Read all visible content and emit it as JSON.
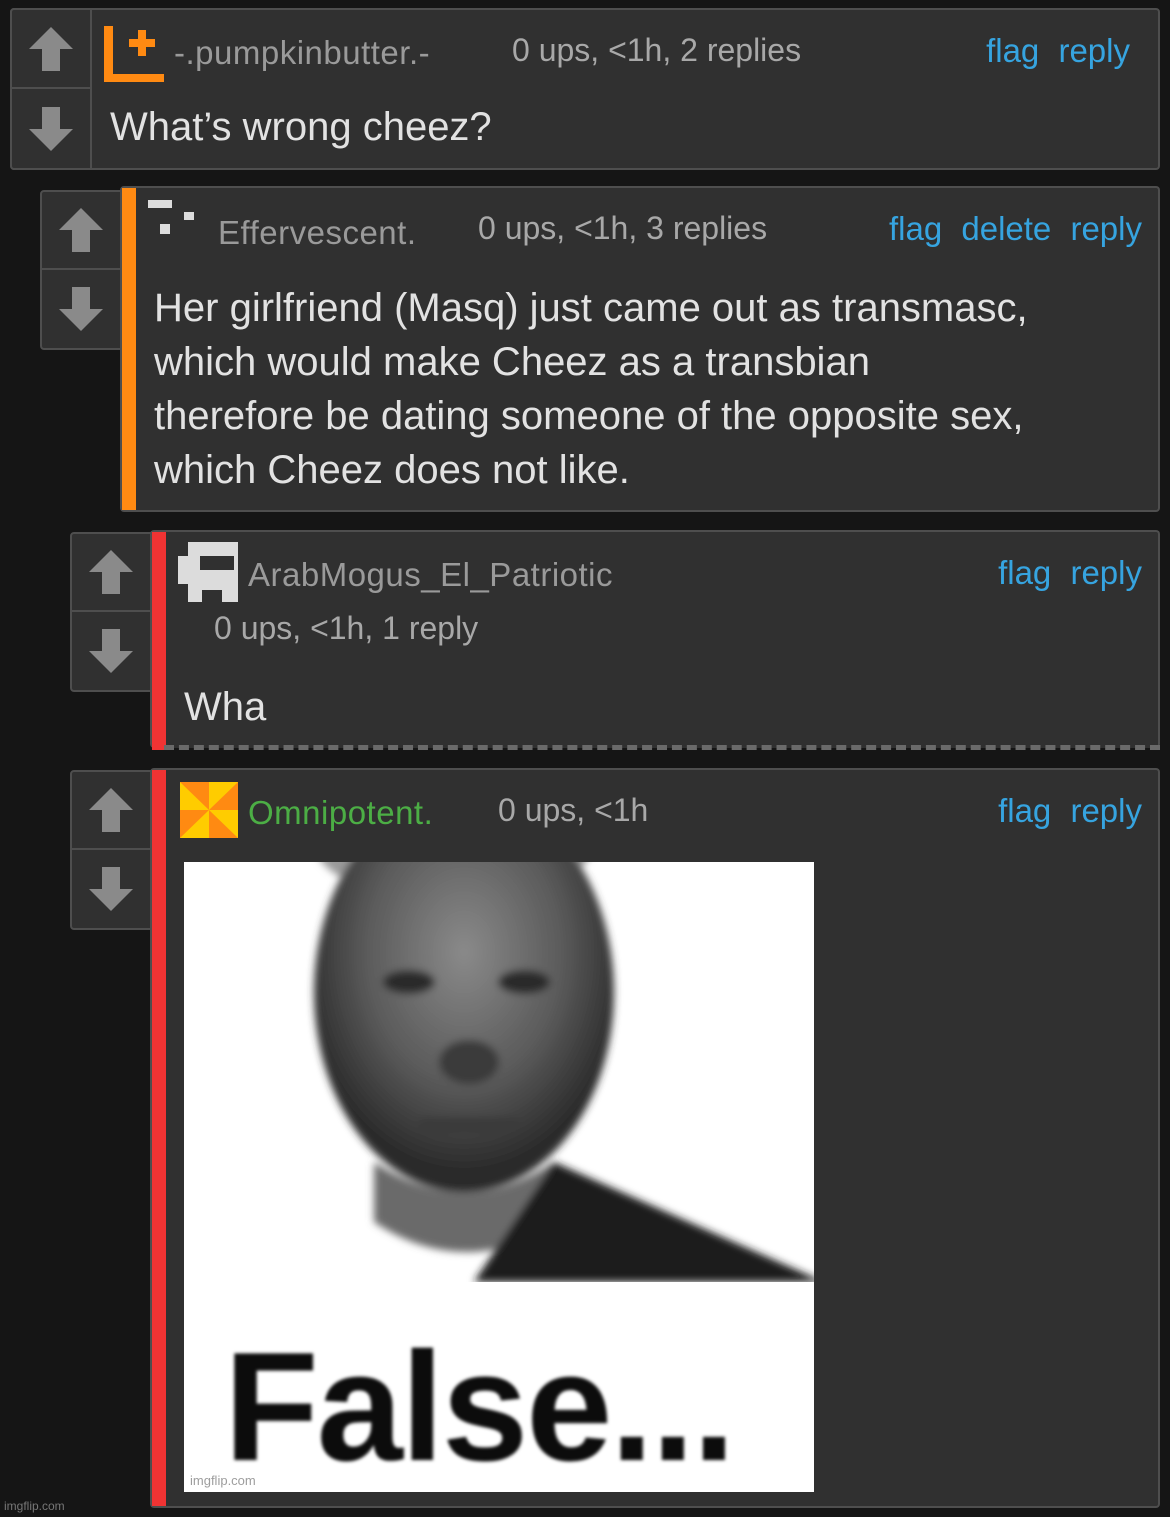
{
  "comments": [
    {
      "username": "-.pumpkinbutter.-",
      "meta": "0 ups, <1h, 2 replies",
      "actions": [
        "flag",
        "reply"
      ],
      "text": "What’s wrong cheez?"
    },
    {
      "username": "Effervescent.",
      "meta": "0 ups, <1h, 3 replies",
      "actions": [
        "flag",
        "delete",
        "reply"
      ],
      "text": [
        "Her girlfriend (Masq) just came out as transmasc,",
        "which would make Cheez as a transbian",
        "therefore be dating someone of the opposite sex,",
        "which Cheez does not like."
      ]
    },
    {
      "username": "ArabMogus_El_Patriotic",
      "meta": "0 ups, <1h, 1 reply",
      "actions": [
        "flag",
        "reply"
      ],
      "text": "Wha"
    },
    {
      "username": "Omnipotent.",
      "meta": "0 ups, <1h",
      "actions": [
        "flag",
        "reply"
      ],
      "image_caption": "False...",
      "image_watermark": "imgflip.com"
    }
  ],
  "page_watermark": "imgflip.com",
  "colors": {
    "orange_bar": "#ff8a12",
    "red_bar": "#f03333",
    "link": "#36a4e0",
    "green_username": "#4cae45"
  },
  "icons": [
    "upvote-arrow-icon",
    "downvote-arrow-icon"
  ]
}
